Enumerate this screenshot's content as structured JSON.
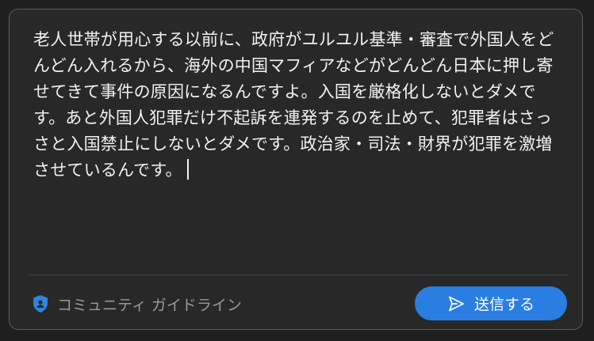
{
  "composer": {
    "comment_text": "老人世帯が用心する以前に、政府がユルユル基準・審査で外国人をどんどん入れるから、海外の中国マフィアなどがどんどん日本に押し寄せてきて事件の原因になるんですよ。入国を厳格化しないとダメです。あと外国人犯罪だけ不起訴を連発するのを止めて、犯罪者はさっさと入国禁止にしないとダメです。政治家・司法・財界が犯罪を激増させているんです。"
  },
  "footer": {
    "guidelines_label": "コミュニティ ガイドライン",
    "guidelines_icon": "shield-icon",
    "send_label": "送信する",
    "send_icon": "send-icon"
  },
  "colors": {
    "background": "#1f1f1f",
    "panel": "#282828",
    "border": "#5a5a5a",
    "text": "#f2f2f2",
    "muted": "#9a9a9a",
    "accent": "#2a7de1",
    "shield": "#2f84e0"
  }
}
